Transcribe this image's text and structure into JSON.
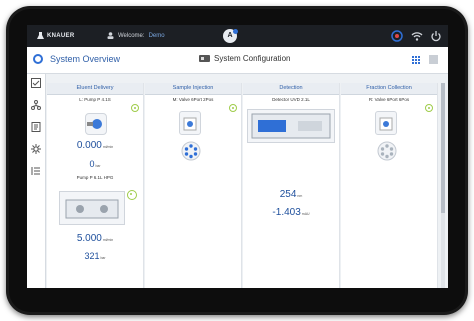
{
  "statusbar": {
    "brand": "KNAUER",
    "welcome_label": "Welcome:",
    "user": "Demo",
    "center_icon_letter": "A"
  },
  "header": {
    "title": "System Overview",
    "system_configuration": "System Configuration"
  },
  "panels": [
    {
      "title": "Eluent Delivery",
      "modules": [
        {
          "name": "L: Pump P 4.1S",
          "values": [
            {
              "value": "0.000",
              "unit": "ml/min"
            },
            {
              "value": "0",
              "unit": "bar"
            }
          ]
        },
        {
          "name": "Pump P 6.1L HPG",
          "values": [
            {
              "value": "5.000",
              "unit": "ml/min"
            },
            {
              "value": "321",
              "unit": "bar"
            }
          ]
        }
      ]
    },
    {
      "title": "Sample Injection",
      "modules": [
        {
          "name": "M: Valve 6Port 2Pos",
          "values": []
        }
      ]
    },
    {
      "title": "Detection",
      "modules": [
        {
          "name": "Detector UVD 2.1L",
          "values": [
            {
              "value": "254",
              "unit": "nm"
            },
            {
              "value": "-1.403",
              "unit": "mAU"
            }
          ]
        }
      ]
    },
    {
      "title": "Fraction Collection",
      "modules": [
        {
          "name": "R: Valve 6Port 6Pos",
          "values": []
        }
      ]
    }
  ],
  "colors": {
    "accent": "#2f6fd6",
    "status_ok": "#9fcc4a",
    "value_text": "#1e4f9c",
    "statusbar_bg": "#1c1f24"
  },
  "icons": {
    "statusbar": [
      "user-icon",
      "notification-icon",
      "wifi-icon",
      "power-icon"
    ],
    "sidebar": [
      "overview-icon",
      "checklist-icon",
      "network-icon",
      "report-icon",
      "settings-icon",
      "list-icon"
    ],
    "header": [
      "system-configuration-icon",
      "grid-view-icon",
      "layout-toggle-icon"
    ]
  }
}
